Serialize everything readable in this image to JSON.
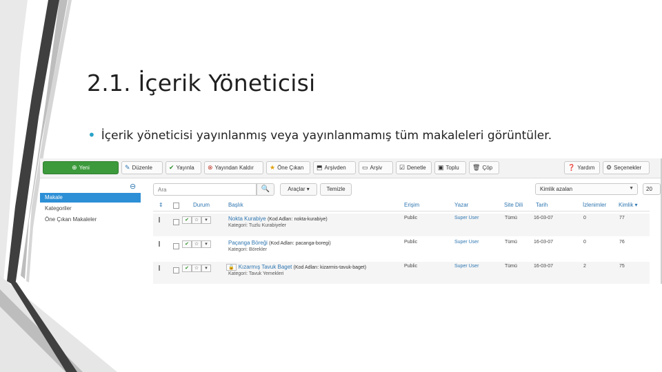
{
  "slide": {
    "title": "2.1. İçerik Yöneticisi",
    "bullet": "İçerik yöneticisi yayınlanmış veya yayınlanmamış tüm makaleleri görüntüler."
  },
  "toolbar": {
    "buttons": [
      {
        "label": "Yeni",
        "icon": "plus-icon"
      },
      {
        "label": "Düzenle",
        "icon": "edit-icon"
      },
      {
        "label": "Yayınla",
        "icon": "check-icon"
      },
      {
        "label": "Yayından Kaldır",
        "icon": "unpublish-icon"
      },
      {
        "label": "Öne Çıkan",
        "icon": "star-icon"
      },
      {
        "label": "Arşivden",
        "icon": "unarchive-icon"
      },
      {
        "label": "Arşiv",
        "icon": "archive-icon"
      },
      {
        "label": "Denetle",
        "icon": "checkin-icon"
      },
      {
        "label": "Toplu",
        "icon": "batch-icon"
      },
      {
        "label": "Çöp",
        "icon": "trash-icon"
      },
      {
        "label": "Yardım",
        "icon": "help-icon"
      },
      {
        "label": "Seçenekler",
        "icon": "gear-icon"
      }
    ]
  },
  "sidebar": {
    "items": [
      "Makale",
      "Kategoriler",
      "Öne Çıkan Makaleler"
    ],
    "active_index": 0
  },
  "filter": {
    "search_placeholder": "Ara",
    "tools_label": "Araçlar ▾",
    "clear_label": "Temizle",
    "sort_value": "Kimlik azalan",
    "limit_value": "20"
  },
  "table": {
    "headers": {
      "ordering": "⇕",
      "status": "Durum",
      "title": "Başlık",
      "access": "Erişim",
      "author": "Yazar",
      "language": "Site Dili",
      "date": "Tarih",
      "hits": "İzlenimler",
      "id": "Kimlik ▾"
    },
    "rows": [
      {
        "title": "Nokta Kurabiye",
        "alias": "(Kod Adları: nokta-kurabiye)",
        "category": "Kategori: Tuzlu Kurabiyeler",
        "access": "Public",
        "author": "Super User",
        "language": "Tümü",
        "date": "16-03-07",
        "hits": "0",
        "id": "77",
        "locked": false
      },
      {
        "title": "Paçanga Böreği",
        "alias": "(Kod Adları: pacanga-boregi)",
        "category": "Kategori: Börekler",
        "access": "Public",
        "author": "Super User",
        "language": "Tümü",
        "date": "16-03-07",
        "hits": "0",
        "id": "76",
        "locked": false
      },
      {
        "title": "Kızarmış Tavuk Baget",
        "alias": "(Kod Adları: kizarmis-tavuk-baget)",
        "category": "Kategori: Tavuk Yemekleri",
        "access": "Public",
        "author": "Super User",
        "language": "Tümü",
        "date": "16-03-07",
        "hits": "2",
        "id": "75",
        "locked": true
      }
    ]
  },
  "colors": {
    "accent": "#2aa3c7",
    "link": "#2d75b0",
    "new_button": "#3c9a3c",
    "active_sidebar": "#2d8fd6",
    "deco_dark": "#3f3f3f",
    "deco_light": "#b8b8b8"
  }
}
